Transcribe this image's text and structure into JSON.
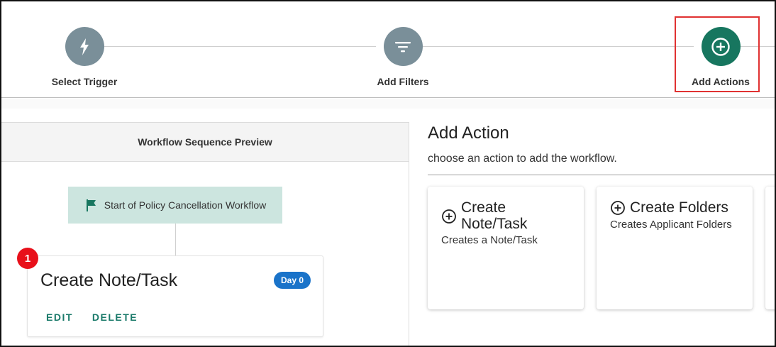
{
  "stepper": {
    "steps": [
      {
        "label": "Select Trigger",
        "icon": "lightning-bolt-icon",
        "state": "inactive"
      },
      {
        "label": "Add Filters",
        "icon": "filter-icon",
        "state": "inactive"
      },
      {
        "label": "Add Actions",
        "icon": "add-circle-icon",
        "state": "active"
      }
    ]
  },
  "preview": {
    "header": "Workflow Sequence Preview",
    "start_node": "Start of Policy Cancellation Workflow",
    "action": {
      "number": "1",
      "title": "Create Note/Task",
      "day_chip": "Day 0",
      "edit_label": "EDIT",
      "delete_label": "DELETE"
    }
  },
  "add_action": {
    "title": "Add Action",
    "subtitle": "choose an action to add the workflow.",
    "options": [
      {
        "title_line1": "Create",
        "title_line2": "Note/Task",
        "description": "Creates a Note/Task"
      },
      {
        "title_line1": "Create Folders",
        "description": "Creates Applicant Folders"
      }
    ]
  },
  "colors": {
    "step_inactive": "#7a8f99",
    "step_active": "#17765f",
    "start_node_bg": "#cce5df",
    "day_chip": "#1a73c9",
    "badge": "#e8101a",
    "action_link": "#1a7a6a",
    "highlight": "#e03131"
  }
}
